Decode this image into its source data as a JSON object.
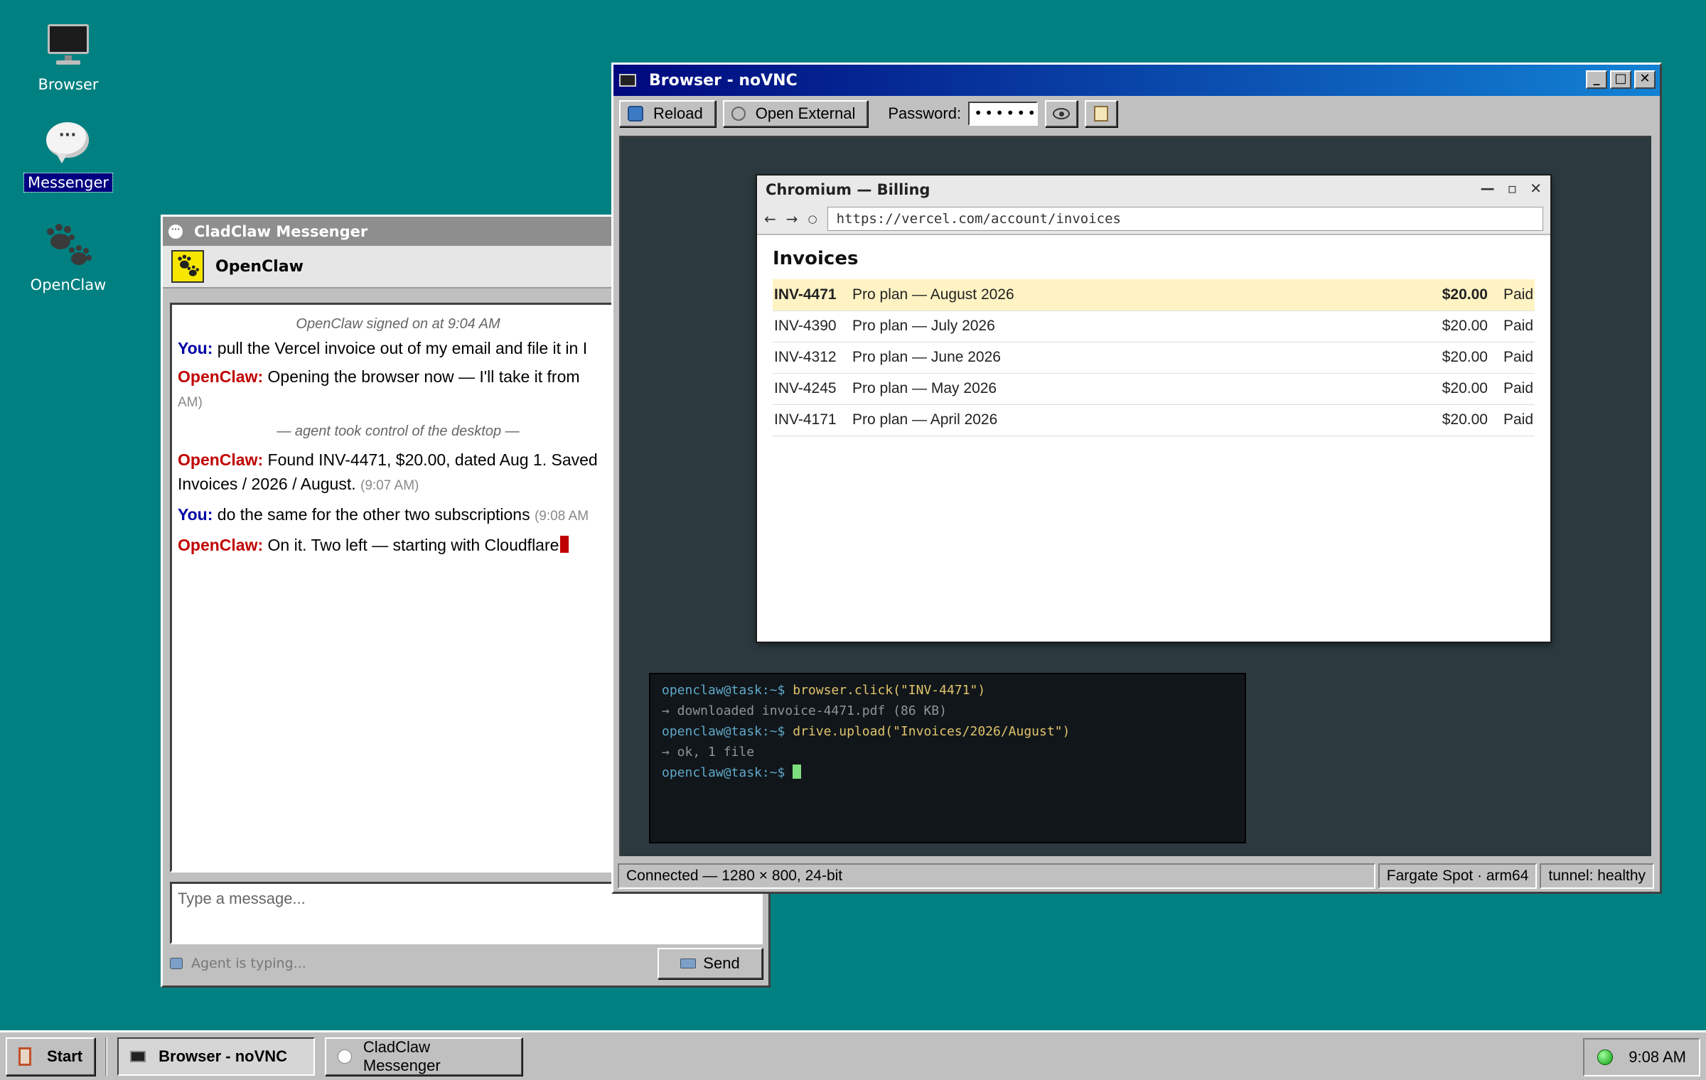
{
  "desktop": {
    "icons": [
      {
        "label": "Browser",
        "icon": "monitor-icon"
      },
      {
        "label": "Messenger",
        "icon": "chat-bubble-icon"
      },
      {
        "label": "OpenClaw",
        "icon": "paw-icon"
      }
    ]
  },
  "messenger": {
    "title": "CladClaw Messenger",
    "contact": "OpenClaw",
    "signon": "OpenClaw signed on at 9:04 AM",
    "messages": [
      {
        "who": "You:",
        "text": "pull the Vercel invoice out of my email and file it in I",
        "time": ""
      },
      {
        "who": "OpenClaw:",
        "text": "Opening the browser now — I'll take it from",
        "time": "AM)"
      },
      {
        "who": "OpenClaw:",
        "text": "Found INV-4471, $20.00, dated Aug 1. Saved Invoices / 2026 / August.",
        "time": "(9:07 AM)"
      },
      {
        "who": "You:",
        "text": "do the same for the other two subscriptions",
        "time": "(9:08 AM"
      },
      {
        "who": "OpenClaw:",
        "text": "On it. Two left — starting with Cloudflare",
        "time": ""
      }
    ],
    "control_notice": "— agent took control of the desktop —",
    "compose_placeholder": "Type a message...",
    "typing_status": "Agent is typing...",
    "send_label": "Send"
  },
  "vnc": {
    "title": "Browser - noVNC",
    "toolbar": {
      "reload": "Reload",
      "open_external": "Open External",
      "password_label": "Password:",
      "password_value": "••••••"
    },
    "status": {
      "connection": "Connected — 1280 × 800, 24-bit",
      "host": "Fargate Spot · arm64",
      "tunnel": "tunnel: healthy"
    }
  },
  "chromium": {
    "title": "Chromium — Billing",
    "url": "https://vercel.com/account/invoices",
    "heading": "Invoices",
    "invoices": [
      {
        "id": "INV-4471",
        "desc": "Pro plan — August 2026",
        "amount": "$20.00",
        "status": "Paid"
      },
      {
        "id": "INV-4390",
        "desc": "Pro plan — July 2026",
        "amount": "$20.00",
        "status": "Paid"
      },
      {
        "id": "INV-4312",
        "desc": "Pro plan — June 2026",
        "amount": "$20.00",
        "status": "Paid"
      },
      {
        "id": "INV-4245",
        "desc": "Pro plan — May 2026",
        "amount": "$20.00",
        "status": "Paid"
      },
      {
        "id": "INV-4171",
        "desc": "Pro plan — April 2026",
        "amount": "$20.00",
        "status": "Paid"
      }
    ]
  },
  "terminal": {
    "prompt": "openclaw@task:~$",
    "lines": [
      {
        "kind": "cmd",
        "text": "browser.click(\"INV-4471\")"
      },
      {
        "kind": "out",
        "text": "→ downloaded invoice-4471.pdf (86 KB)"
      },
      {
        "kind": "cmd",
        "text": "drive.upload(\"Invoices/2026/August\")"
      },
      {
        "kind": "out",
        "text": "→ ok, 1 file"
      }
    ]
  },
  "taskbar": {
    "start": "Start",
    "tasks": [
      "Browser - noVNC",
      "CladClaw Messenger"
    ],
    "clock": "9:08 AM"
  }
}
